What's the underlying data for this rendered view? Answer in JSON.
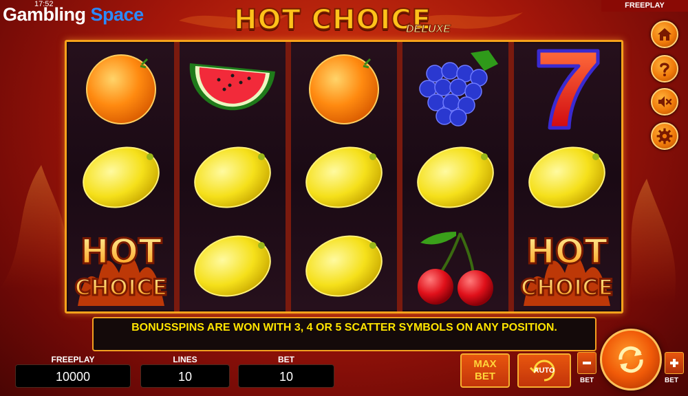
{
  "status_bar": {
    "time": "17:52"
  },
  "brand": {
    "word1": "Gambling",
    "word2": "Space"
  },
  "game": {
    "title": "HOT CHOICE",
    "subtitle": "DELUXE"
  },
  "mode_badge": "FREEPLAY",
  "reels": [
    [
      "orange",
      "lemon",
      "hot-choice"
    ],
    [
      "watermelon",
      "lemon",
      "lemon"
    ],
    [
      "orange",
      "lemon",
      "lemon"
    ],
    [
      "grapes",
      "lemon",
      "cherries"
    ],
    [
      "seven",
      "lemon",
      "hot-choice"
    ]
  ],
  "scatter_symbol": {
    "line1": "HOT",
    "line2": "CHOICE"
  },
  "info_message": "BONUSSPINS ARE WON WITH 3, 4 OR 5 SCATTER SYMBOLS ON ANY POSITION.",
  "stats": {
    "freeplay": {
      "label": "FREEPLAY",
      "value": "10000"
    },
    "lines": {
      "label": "LINES",
      "value": "10"
    },
    "bet": {
      "label": "BET",
      "value": "10"
    }
  },
  "buttons": {
    "max_bet": {
      "line1": "MAX",
      "line2": "BET"
    },
    "auto": "AUTO",
    "bet_minus_label": "BET",
    "bet_plus_label": "BET"
  },
  "side_icons": [
    "home-icon",
    "help-icon",
    "sound-off-icon",
    "settings-icon"
  ],
  "colors": {
    "accent": "#f7a21b",
    "info_text": "#ffe400",
    "brand_blue": "#2a8bff",
    "mode_badge_bg": "#8a0a05"
  }
}
